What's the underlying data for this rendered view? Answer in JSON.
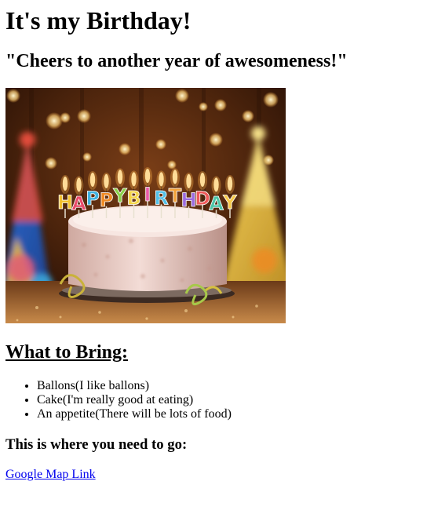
{
  "heading": "It's my Birthday!",
  "subtitle": "\"Cheers to another year of awesomeness!\"",
  "photo": {
    "candle_text": "HAPPY BIRTHDAY",
    "candle_colors": [
      "#f2c12e",
      "#e94b6a",
      "#3fb3e0",
      "#f08a24",
      "#8bd14a",
      "#f5d547",
      "#e85aa8",
      "#53c1e8",
      "#f2a23a",
      "#9b6be0",
      "#f05a5a",
      "#4fc6a8",
      "#f7c948"
    ]
  },
  "what_to_bring": {
    "title": "What to Bring:",
    "items": [
      "Ballons(I like ballons)",
      "Cake(I'm really good at eating)",
      "An appetite(There will be lots of food)"
    ]
  },
  "directions": {
    "title": "This is where you need to go:",
    "link_text": "Google Map Link",
    "link_color": "#0000ee"
  }
}
